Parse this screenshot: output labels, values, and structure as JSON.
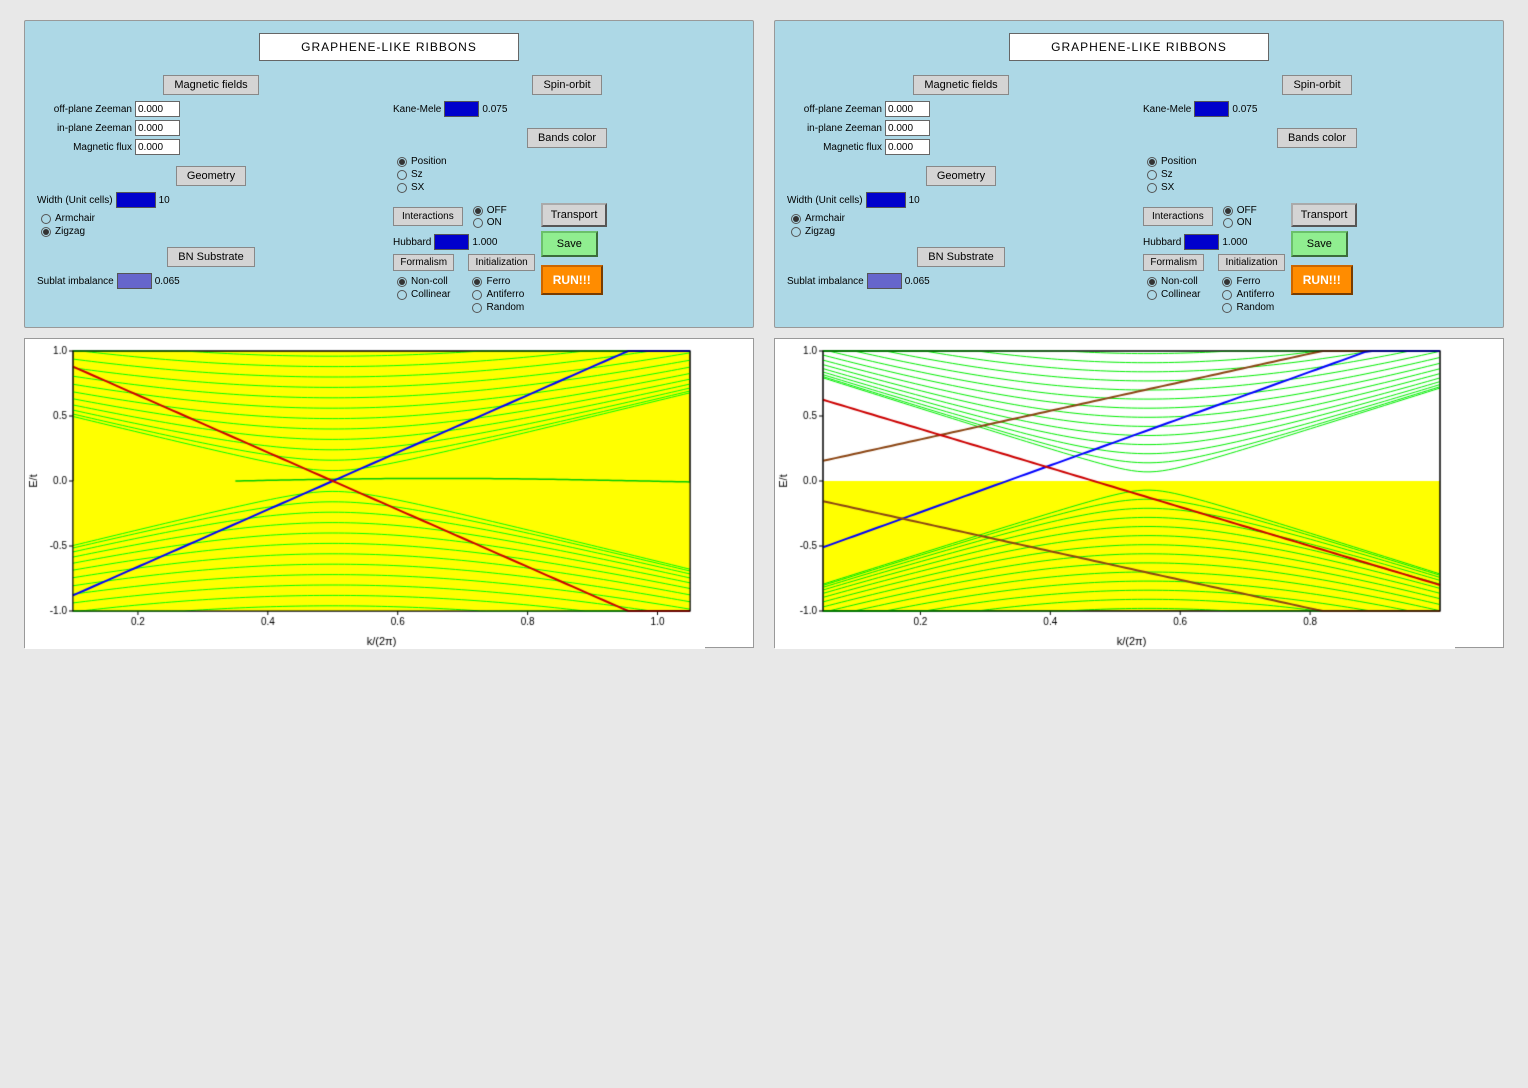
{
  "panels": [
    {
      "title": "GRAPHENE-LIKE RIBBONS",
      "magnetic_fields": {
        "label": "Magnetic fields",
        "off_plane_zeeman": {
          "label": "off-plane Zeeman",
          "value": "0.000"
        },
        "in_plane_zeeman": {
          "label": "in-plane Zeeman",
          "value": "0.000"
        },
        "magnetic_flux": {
          "label": "Magnetic flux",
          "value": "0.000"
        }
      },
      "spin_orbit": {
        "label": "Spin-orbit",
        "kane_mele": {
          "label": "Kane-Mele",
          "value": "0.075"
        }
      },
      "bands_color": {
        "label": "Bands color",
        "options": [
          "Position",
          "Sz",
          "SX"
        ],
        "selected": 0
      },
      "geometry": {
        "label": "Geometry",
        "width_label": "Width (Unit cells)",
        "width_value": "10",
        "options": [
          "Armchair",
          "Zigzag"
        ],
        "selected": 1
      },
      "interactions": {
        "label": "Interactions",
        "off_label": "OFF",
        "on_label": "ON",
        "selected": "OFF"
      },
      "hubbard": {
        "label": "Hubbard",
        "value": "1.000"
      },
      "bn_substrate": {
        "label": "BN Substrate"
      },
      "sublat_imbalance": {
        "label": "Sublat imbalance",
        "value": "0.065"
      },
      "formalism": {
        "label": "Formalism",
        "options": [
          "Non-coll",
          "Collinear"
        ],
        "selected": 0
      },
      "initialization": {
        "label": "Initialization",
        "options": [
          "Ferro",
          "Antiferro",
          "Random"
        ],
        "selected": 0
      },
      "transport_label": "Transport",
      "save_label": "Save",
      "run_label": "RUN!!!"
    },
    {
      "title": "GRAPHENE-LIKE RIBBONS",
      "magnetic_fields": {
        "label": "Magnetic fields",
        "off_plane_zeeman": {
          "label": "off-plane Zeeman",
          "value": "0.000"
        },
        "in_plane_zeeman": {
          "label": "in-plane Zeeman",
          "value": "0.000"
        },
        "magnetic_flux": {
          "label": "Magnetic flux",
          "value": "0.000"
        }
      },
      "spin_orbit": {
        "label": "Spin-orbit",
        "kane_mele": {
          "label": "Kane-Mele",
          "value": "0.075"
        }
      },
      "bands_color": {
        "label": "Bands color",
        "options": [
          "Position",
          "Sz",
          "SX"
        ],
        "selected": 0
      },
      "geometry": {
        "label": "Geometry",
        "width_label": "Width (Unit cells)",
        "width_value": "10",
        "options": [
          "Armchair",
          "Zigzag"
        ],
        "selected": 1
      },
      "interactions": {
        "label": "Interactions",
        "off_label": "OFF",
        "on_label": "ON",
        "selected": "OFF"
      },
      "hubbard": {
        "label": "Hubbard",
        "value": "1.000"
      },
      "bn_substrate": {
        "label": "BN Substrate"
      },
      "sublat_imbalance": {
        "label": "Sublat imbalance",
        "value": "0.065"
      },
      "formalism": {
        "label": "Formalism",
        "options": [
          "Non-coll",
          "Collinear"
        ],
        "selected": 0
      },
      "initialization": {
        "label": "Initialization",
        "options": [
          "Ferro",
          "Antiferro",
          "Random"
        ],
        "selected": 0
      },
      "transport_label": "Transport",
      "save_label": "Save",
      "run_label": "RUN!!!"
    }
  ],
  "plots": [
    {
      "type": "zigzag",
      "y_label": "E/t",
      "x_label": "k/(2π)",
      "y_max": 1.0,
      "y_min": -1.0,
      "x_ticks": [
        0.2,
        0.4,
        0.6,
        0.8,
        1.0
      ]
    },
    {
      "type": "armchair",
      "y_label": "E/t",
      "x_label": "k/(2π)",
      "y_max": 1.0,
      "y_min": -1.0,
      "x_ticks": [
        0.2,
        0.4,
        0.6,
        0.8
      ]
    }
  ]
}
